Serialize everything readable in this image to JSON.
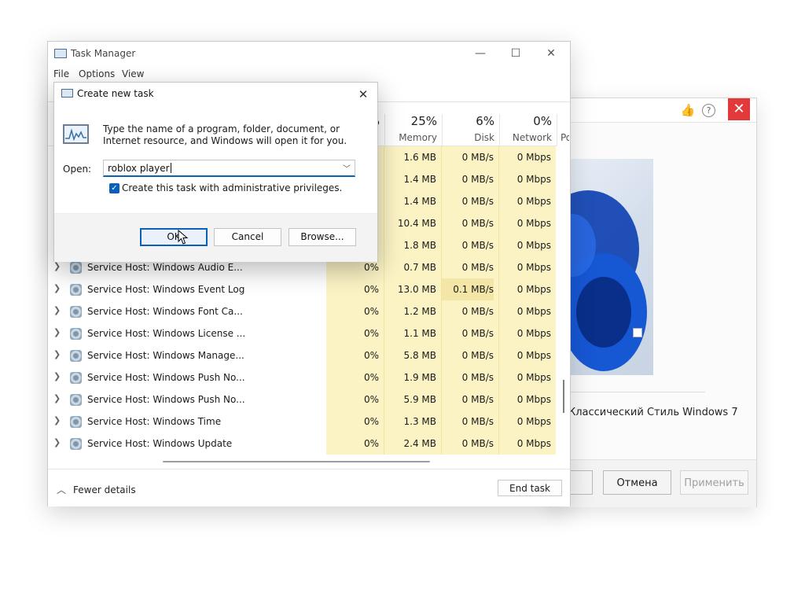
{
  "task_manager": {
    "title": "Task Manager",
    "window_controls": {
      "minimize": "—",
      "maximize": "☐",
      "close": "✕"
    },
    "menu": [
      "File",
      "Options",
      "View"
    ],
    "columns": [
      {
        "pct": "25%",
        "label": "Memory"
      },
      {
        "pct": "6%",
        "label": "Disk"
      },
      {
        "pct": "0%",
        "label": "Network"
      },
      {
        "pct": "",
        "label": "Po"
      }
    ],
    "partial_cpu_header": "%",
    "visible_rows_top": [
      {
        "cpu": "%",
        "memory": "1.6 MB",
        "disk": "0 MB/s",
        "network": "0 Mbps"
      },
      {
        "cpu": "%",
        "memory": "1.4 MB",
        "disk": "0 MB/s",
        "network": "0 Mbps"
      },
      {
        "cpu": "%",
        "memory": "1.4 MB",
        "disk": "0 MB/s",
        "network": "0 Mbps"
      },
      {
        "cpu": "%",
        "memory": "10.4 MB",
        "disk": "0 MB/s",
        "network": "0 Mbps"
      },
      {
        "cpu": "%",
        "memory": "1.8 MB",
        "disk": "0 MB/s",
        "network": "0 Mbps"
      }
    ],
    "processes": [
      {
        "name": "Service Host: Windows Audio E...",
        "cpu": "0%",
        "memory": "0.7 MB",
        "disk": "0 MB/s",
        "network": "0 Mbps"
      },
      {
        "name": "Service Host: Windows Event Log",
        "cpu": "0%",
        "memory": "13.0 MB",
        "disk": "0.1 MB/s",
        "network": "0 Mbps"
      },
      {
        "name": "Service Host: Windows Font Ca...",
        "cpu": "0%",
        "memory": "1.2 MB",
        "disk": "0 MB/s",
        "network": "0 Mbps"
      },
      {
        "name": "Service Host: Windows License ...",
        "cpu": "0%",
        "memory": "1.1 MB",
        "disk": "0 MB/s",
        "network": "0 Mbps"
      },
      {
        "name": "Service Host: Windows Manage...",
        "cpu": "0%",
        "memory": "5.8 MB",
        "disk": "0 MB/s",
        "network": "0 Mbps"
      },
      {
        "name": "Service Host: Windows Push No...",
        "cpu": "0%",
        "memory": "1.9 MB",
        "disk": "0 MB/s",
        "network": "0 Mbps"
      },
      {
        "name": "Service Host: Windows Push No...",
        "cpu": "0%",
        "memory": "5.9 MB",
        "disk": "0 MB/s",
        "network": "0 Mbps"
      },
      {
        "name": "Service Host: Windows Time",
        "cpu": "0%",
        "memory": "1.3 MB",
        "disk": "0 MB/s",
        "network": "0 Mbps"
      },
      {
        "name": "Service Host: Windows Update",
        "cpu": "0%",
        "memory": "2.4 MB",
        "disk": "0 MB/s",
        "network": "0 Mbps"
      }
    ],
    "fewer_details": "Fewer details",
    "end_task": "End task"
  },
  "run_dialog": {
    "title": "Create new task",
    "close": "✕",
    "message": "Type the name of a program, folder, document, or Internet resource, and Windows will open it for you.",
    "open_label": "Open:",
    "open_value": "roblox player",
    "admin_checkbox_label": "Create this task with administrative privileges.",
    "admin_checked": true,
    "buttons": {
      "ok": "OK",
      "cancel": "Cancel",
      "browse": "Browse..."
    }
  },
  "background_window": {
    "close": "✕",
    "theme_title": "Классический Стиль Windows 7",
    "buttons": {
      "cancel": "Отмена",
      "apply": "Применить"
    },
    "icons": [
      "thumbs-up-icon",
      "help-icon",
      "close-icon"
    ]
  },
  "colors": {
    "accent": "#0a5fb8",
    "highlight_cell": "#fbf3c4",
    "close_red": "#e23a3a"
  }
}
